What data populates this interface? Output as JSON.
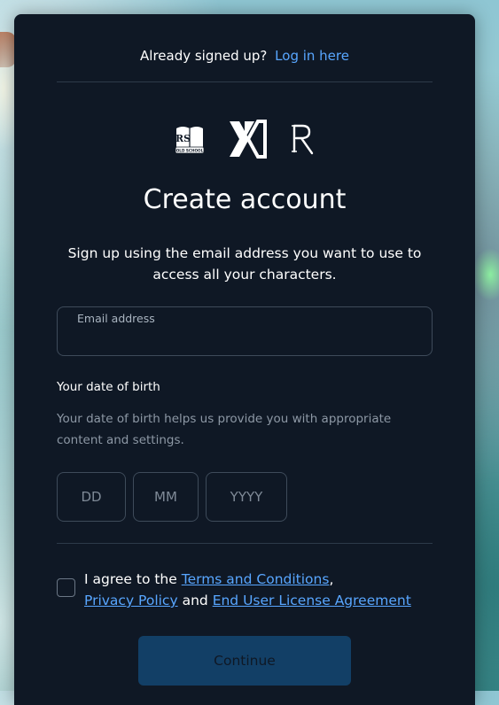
{
  "header": {
    "already_text": "Already signed up?",
    "login_link": "Log in here"
  },
  "logos": [
    {
      "name": "old-school-runescape-logo",
      "lines": [
        "RS",
        "OLD SCHOOL"
      ]
    },
    {
      "name": "jagex-logo",
      "text": "X"
    },
    {
      "name": "runescape-logo",
      "text": "R"
    }
  ],
  "title": "Create account",
  "subtitle": "Sign up using the email address you want to use to access all your characters.",
  "email": {
    "label": "Email address",
    "value": "",
    "placeholder": ""
  },
  "dob": {
    "title": "Your date of birth",
    "help": "Your date of birth helps us provide you with appropriate content and settings.",
    "day_placeholder": "DD",
    "month_placeholder": "MM",
    "year_placeholder": "YYYY"
  },
  "agree": {
    "prefix": "I agree to the",
    "terms": "Terms and Conditions",
    "comma": ",",
    "privacy": "Privacy Policy",
    "and": "and",
    "eula": "End User License Agreement"
  },
  "continue_label": "Continue",
  "colors": {
    "panel": "#0f1825",
    "link": "#58a6ff",
    "button_disabled": "#123f66"
  }
}
